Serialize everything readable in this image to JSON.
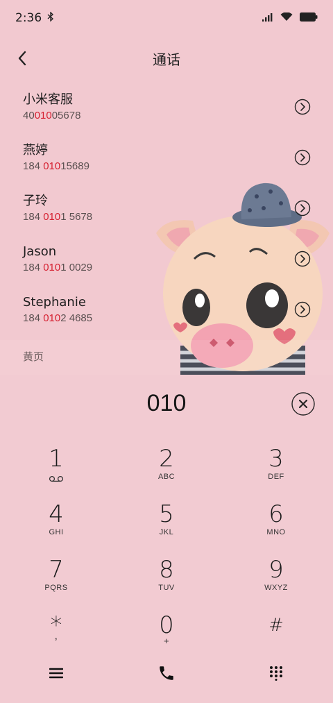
{
  "status_bar": {
    "time": "2:36",
    "bluetooth": "bluetooth-icon"
  },
  "header": {
    "title": "通话"
  },
  "contacts": [
    {
      "name": "小米客服",
      "number_pre": "40",
      "number_hl": "010",
      "number_post": "05678"
    },
    {
      "name": "燕婷",
      "number_pre": "184 ",
      "number_hl": "010",
      "number_post": "15689"
    },
    {
      "name": "子玲",
      "number_pre": "184 ",
      "number_hl": "010",
      "number_post": "1 5678"
    },
    {
      "name": "Jason",
      "number_pre": "184 ",
      "number_hl": "010",
      "number_post": "1 0029"
    },
    {
      "name": "Stephanie",
      "number_pre": "184 ",
      "number_hl": "010",
      "number_post": "2 4685"
    }
  ],
  "section": {
    "label": "黄页"
  },
  "dialer": {
    "digits": "010",
    "keys": [
      {
        "num": "1",
        "letters": ""
      },
      {
        "num": "2",
        "letters": "ABC"
      },
      {
        "num": "3",
        "letters": "DEF"
      },
      {
        "num": "4",
        "letters": "GHI"
      },
      {
        "num": "5",
        "letters": "JKL"
      },
      {
        "num": "6",
        "letters": "MNO"
      },
      {
        "num": "7",
        "letters": "PQRS"
      },
      {
        "num": "8",
        "letters": "TUV"
      },
      {
        "num": "9",
        "letters": "WXYZ"
      },
      {
        "num": "*",
        "letters": ","
      },
      {
        "num": "0",
        "letters": "+"
      },
      {
        "num": "#",
        "letters": ""
      }
    ]
  },
  "colors": {
    "background": "#f2c9d0",
    "highlight": "#d62031"
  }
}
